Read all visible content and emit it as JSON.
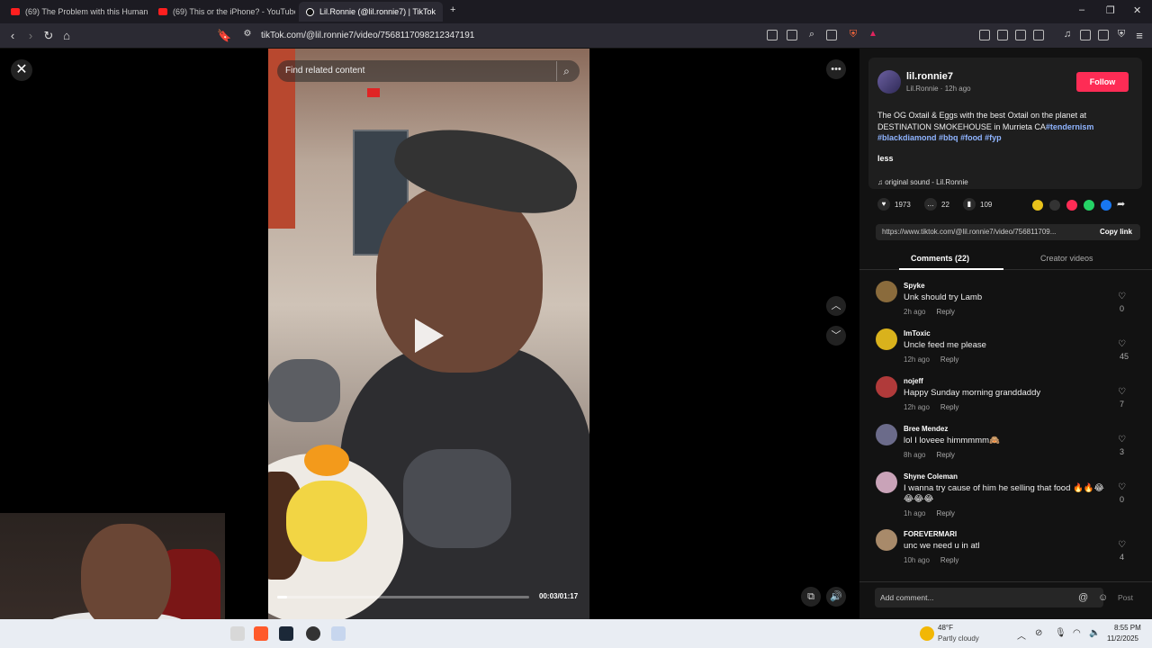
{
  "browser": {
    "tabs": [
      {
        "title": "(69) The Problem with this Humanoid",
        "active": false
      },
      {
        "title": "(69) This or the iPhone? - YouTube",
        "active": false
      },
      {
        "title": "Lil.Ronnie (@lil.ronnie7) | TikTok",
        "active": true
      }
    ],
    "new_tab": "+",
    "url": "tikTok.com/@lil.ronnie7/video/7568117098212347191"
  },
  "video": {
    "search_placeholder": "Find related content",
    "time": "00:03/01:17",
    "progress": 0.04
  },
  "post": {
    "username": "lil.ronnie7",
    "subline": "Lil.Ronnie · 12h ago",
    "follow_label": "Follow",
    "desc_text": "The OG Oxtail & Eggs with the best Oxtail on the planet at DESTINATION SMOKEHOUSE in Murrieta CA",
    "tags": [
      "#tendernism",
      "#blackdiamond",
      "#bbq",
      "#food",
      "#fyp"
    ],
    "less_label": "less",
    "sound": "original sound - Lil.Ronnie",
    "likes": "1973",
    "comments_count": "22",
    "saves": "109",
    "link": "https://www.tiktok.com/@lil.ronnie7/video/756811709...",
    "copy_label": "Copy link"
  },
  "tabs": {
    "comments": "Comments (22)",
    "creator": "Creator videos"
  },
  "comments": [
    {
      "name": "Spyke",
      "text": "Unk should try Lamb",
      "time": "2h ago",
      "likes": "0",
      "color": "#8a6b3c"
    },
    {
      "name": "ImToxic",
      "text": "Uncle feed me please",
      "time": "12h ago",
      "likes": "45",
      "color": "#d9b21c"
    },
    {
      "name": "nojeff",
      "text": "Happy Sunday morning granddaddy",
      "time": "12h ago",
      "likes": "7",
      "color": "#b03a3a"
    },
    {
      "name": "Bree Mendez",
      "text": "lol I loveee himmmmm🙈",
      "time": "8h ago",
      "likes": "3",
      "color": "#6b6b8a"
    },
    {
      "name": "Shyne Coleman",
      "text": "I wanna try cause of him he selling that food 🔥🔥😂😂😂😂",
      "time": "1h ago",
      "likes": "0",
      "color": "#c9a3b8"
    },
    {
      "name": "FOREVERMARI",
      "text": "unc we need u in atl",
      "time": "10h ago",
      "likes": "4",
      "color": "#a88a6a"
    }
  ],
  "reply_label": "Reply",
  "comment_input": {
    "placeholder": "Add comment...",
    "post_label": "Post"
  },
  "taskbar": {
    "temp": "48°F",
    "weather": "Partly cloudy",
    "time": "8:55 PM",
    "date": "11/2/2025"
  },
  "colors": {
    "accent": "#fe2c55",
    "tag": "#8fb4ff"
  }
}
